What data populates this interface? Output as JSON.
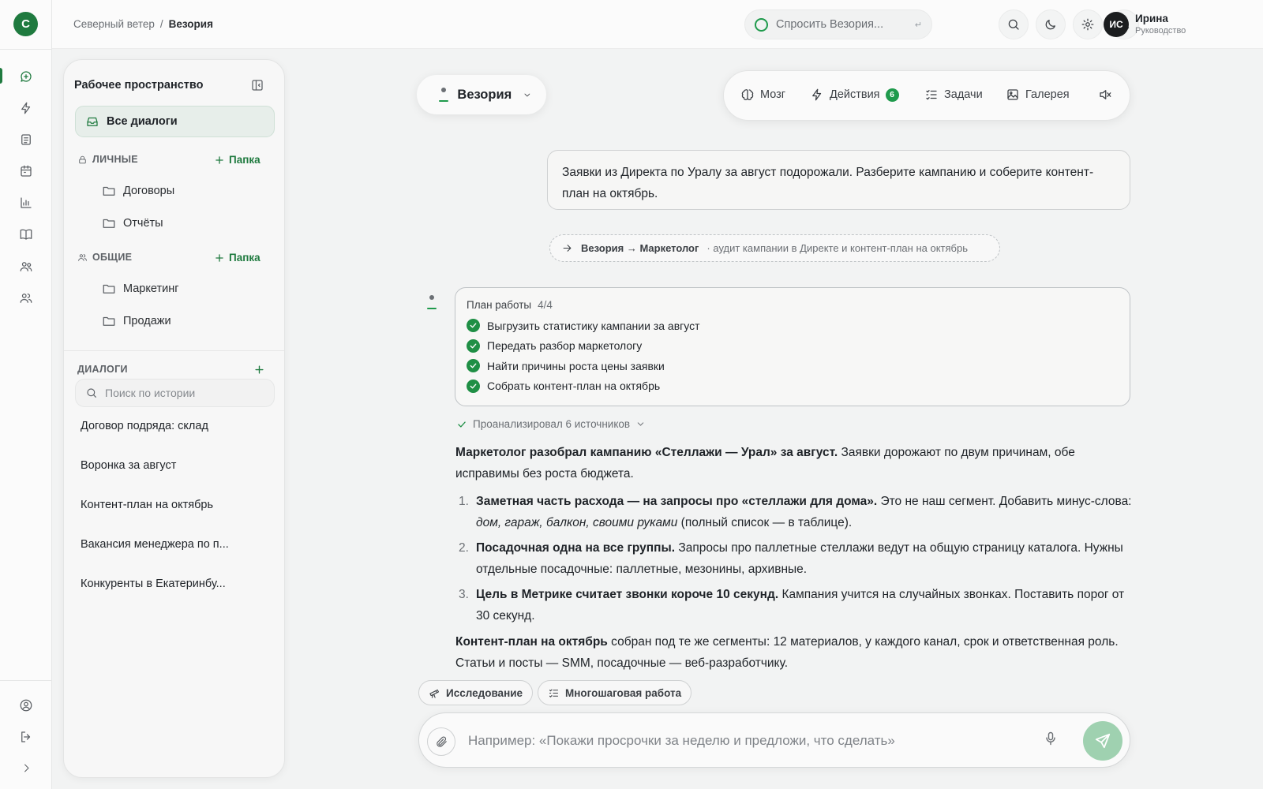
{
  "app": {
    "logo_letter": "С"
  },
  "breadcrumb": {
    "parent": "Северный ветер",
    "separator": "/",
    "current": "Везория"
  },
  "topbar": {
    "ask_placeholder": "Спросить Везория...",
    "ask_shortcut": "↵",
    "user": {
      "initials": "ИС",
      "name": "Ирина",
      "role": "Руководство"
    }
  },
  "rail": {
    "items": [
      "chat-icon",
      "bolt-icon",
      "document-icon",
      "calendar-icon",
      "chart-icon",
      "book-icon",
      "team-icon",
      "users-icon"
    ],
    "bottom": [
      "profile-icon",
      "logout-icon",
      "chevron-right-icon"
    ],
    "active_index": 0
  },
  "workspace": {
    "title": "Рабочее пространство",
    "all_dialogs": "Все диалоги",
    "personal": {
      "label": "ЛИЧНЫЕ",
      "add_label": "Папка",
      "folders": [
        "Договоры",
        "Отчёты"
      ]
    },
    "shared": {
      "label": "ОБЩИЕ",
      "add_label": "Папка",
      "folders": [
        "Маркетинг",
        "Продажи"
      ]
    },
    "dialogs": {
      "label": "ДИАЛОГИ",
      "search_placeholder": "Поиск по истории",
      "items": [
        "Договор подряда: склад",
        "Воронка за август",
        "Контент-план на октябрь",
        "Вакансия менеджера по п...",
        "Конкуренты в Екатеринбу..."
      ]
    }
  },
  "agent": {
    "name": "Везория"
  },
  "toolbar": {
    "brain": "Мозг",
    "actions": "Действия",
    "actions_badge": "6",
    "tasks": "Задачи",
    "gallery": "Галерея"
  },
  "messages": {
    "user_text": "Заявки из Директа по Уралу за август подорожали. Разберите кампанию и соберите контент-план на октябрь.",
    "handoff": {
      "route": "Везория → Маркетолог",
      "note": "· аудит кампании в Директе и контент-план на октябрь"
    },
    "plan": {
      "title": "План работы",
      "count": "4/4",
      "steps": [
        "Выгрузить статистику кампании за август",
        "Передать разбор маркетологу",
        "Найти причины роста цены заявки",
        "Собрать контент-план на октябрь"
      ]
    },
    "sources": "Проанализировал 6 источников",
    "answer": {
      "intro_bold": "Маркетолог разобрал кампанию «Стеллажи — Урал» за август.",
      "intro_rest": " Заявки дорожают по двум причинам, обе исправимы без роста бюджета.",
      "points": [
        {
          "num": "1.",
          "bold": "Заметная часть расхода — на запросы про «стеллажи для дома».",
          "text": " Это не наш сегмент. Добавить минус-слова: ",
          "italic": "дом, гараж, балкон, своими руками",
          "tail": " (полный список — в таблице)."
        },
        {
          "num": "2.",
          "bold": "Посадочная одна на все группы.",
          "text": " Запросы про паллетные стеллажи ведут на общую страницу каталога. Нужны отдельные посадочные: паллетные, мезонины, архивные."
        },
        {
          "num": "3.",
          "bold": "Цель в Метрике считает звонки короче 10 секунд.",
          "text": " Кампания учится на случайных звонках. Поставить порог от 30 секунд."
        }
      ],
      "outro_bold": "Контент-план на октябрь",
      "outro_rest": " собран под те же сегменты: 12 материалов, у каждого канал, срок и ответственная роль. Статьи и посты — SMM, посадочные — веб-разработчику."
    }
  },
  "composer": {
    "modes": [
      "Исследование",
      "Многошаговая работа"
    ],
    "placeholder": "Например: «Покажи просрочки за неделю и предложи, что сделать»"
  },
  "colors": {
    "accent": "#1f7a3f",
    "accent_light": "#9fd1b0",
    "badge": "#1f9a4c"
  }
}
